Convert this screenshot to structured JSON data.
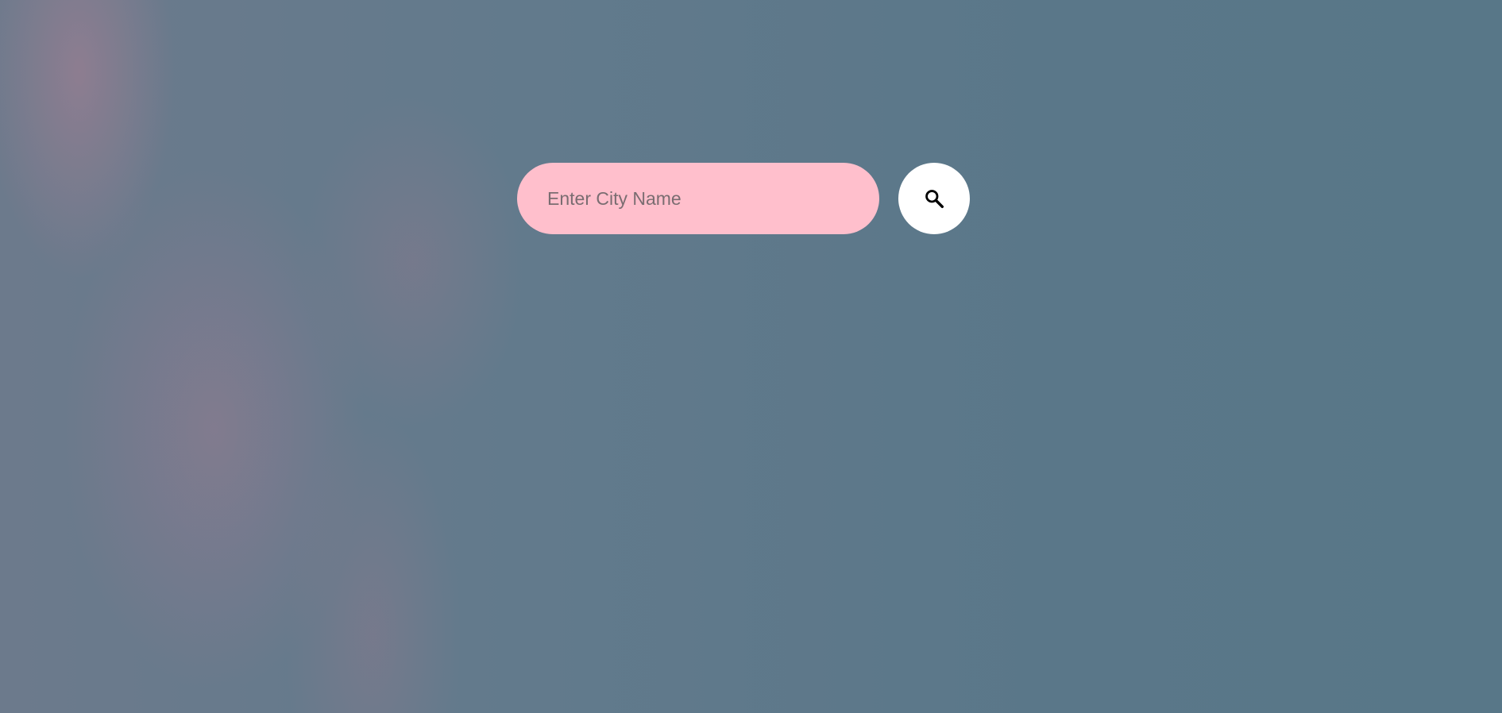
{
  "search": {
    "placeholder": "Enter City Name",
    "value": "",
    "button_icon": "search-icon"
  },
  "colors": {
    "input_background": "#ffbfcc",
    "button_background": "#ffffff",
    "page_background": "#5f7a8b"
  }
}
